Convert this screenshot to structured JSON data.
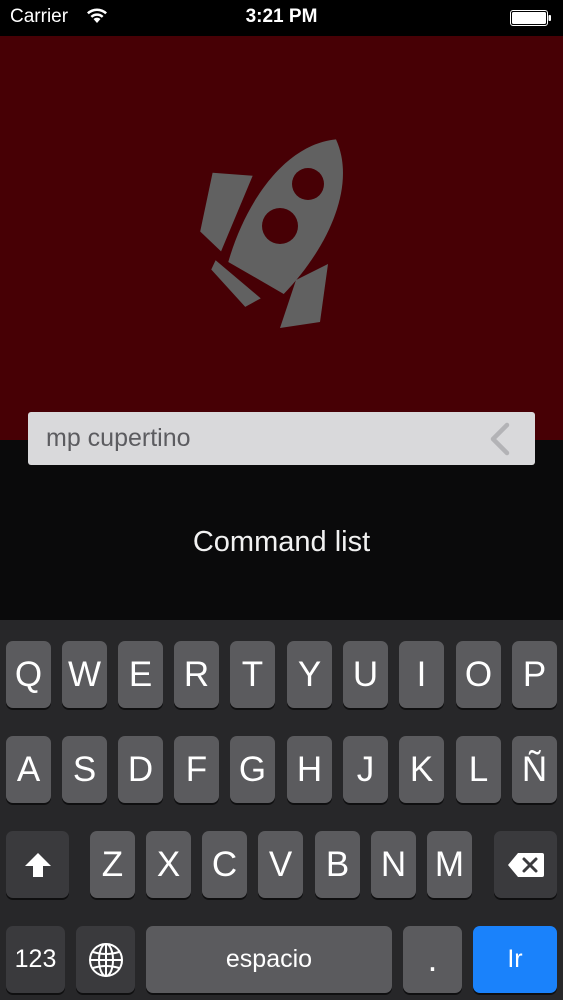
{
  "status_bar": {
    "carrier": "Carrier",
    "time": "3:21 PM"
  },
  "search": {
    "value": "mp cupertino"
  },
  "main": {
    "command_list": "Command list"
  },
  "keyboard": {
    "row1": [
      "Q",
      "W",
      "E",
      "R",
      "T",
      "Y",
      "U",
      "I",
      "O",
      "P"
    ],
    "row2": [
      "A",
      "S",
      "D",
      "F",
      "G",
      "H",
      "J",
      "K",
      "L",
      "Ñ"
    ],
    "row3": [
      "Z",
      "X",
      "C",
      "V",
      "B",
      "N",
      "M"
    ],
    "numbers_label": "123",
    "space_label": "espacio",
    "period_label": ".",
    "go_label": "Ir"
  },
  "colors": {
    "hero_background": "#470005",
    "rocket": "#616161",
    "key": "#5b5b5e",
    "go_key": "#1a82fb"
  }
}
